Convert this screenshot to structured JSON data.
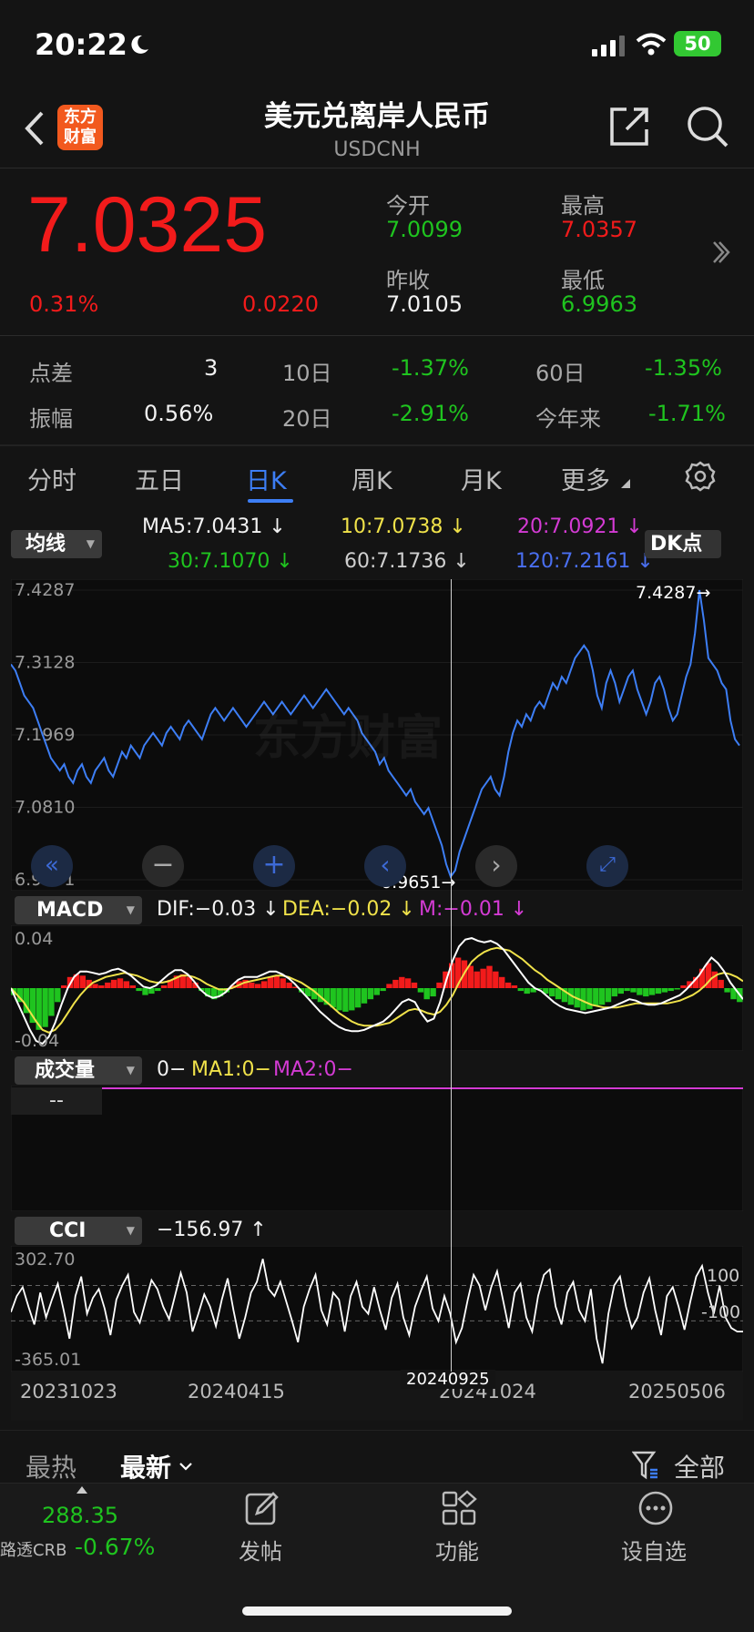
{
  "status": {
    "time": "20:22",
    "battery": "50"
  },
  "header": {
    "title": "美元兑离岸人民币",
    "symbol": "USDCNH",
    "logo_text": "东方财富"
  },
  "quote": {
    "price": "7.0325",
    "change_pct": "0.31%",
    "change": "0.0220",
    "open_label": "今开",
    "open": "7.0099",
    "high_label": "最高",
    "high": "7.0357",
    "prev_label": "昨收",
    "prev": "7.0105",
    "low_label": "最低",
    "low": "6.9963"
  },
  "stats": {
    "spread_label": "点差",
    "spread": "3",
    "d10_label": "10日",
    "d10": "-1.37%",
    "d60_label": "60日",
    "d60": "-1.35%",
    "amp_label": "振幅",
    "amp": "0.56%",
    "d20_label": "20日",
    "d20": "-2.91%",
    "ytd_label": "今年来",
    "ytd": "-1.71%"
  },
  "tabs": [
    {
      "label": "分时"
    },
    {
      "label": "五日"
    },
    {
      "label": "日K"
    },
    {
      "label": "周K"
    },
    {
      "label": "月K"
    },
    {
      "label": "更多"
    }
  ],
  "ma": {
    "pill": "均线",
    "dk": "DK点",
    "ma5": "MA5:7.0431",
    "ma10": "10:7.0738",
    "ma20": "20:7.0921",
    "ma30": "30:7.1070",
    "ma60": "60:7.1736",
    "ma120": "120:7.2161"
  },
  "colors": {
    "accent": "#3d7ef5",
    "up": "#f21b1b",
    "down": "#1fc41f",
    "ma10": "#f0e24a",
    "ma20": "#d43bd4",
    "ma120": "#4a6ff0"
  },
  "chart_data": [
    {
      "type": "line",
      "name": "price",
      "ylim": [
        6.9651,
        7.4287
      ],
      "y_ticks": [
        "7.4287",
        "7.3128",
        "7.1969",
        "7.0810",
        "6.9651"
      ],
      "annotations": {
        "max": "7.4287→",
        "min": "6.9651→"
      },
      "values": [
        7.31,
        7.3,
        7.28,
        7.26,
        7.25,
        7.24,
        7.22,
        7.2,
        7.18,
        7.16,
        7.15,
        7.14,
        7.15,
        7.13,
        7.12,
        7.14,
        7.15,
        7.13,
        7.12,
        7.14,
        7.15,
        7.16,
        7.14,
        7.13,
        7.15,
        7.17,
        7.16,
        7.18,
        7.17,
        7.16,
        7.18,
        7.19,
        7.2,
        7.19,
        7.18,
        7.2,
        7.21,
        7.2,
        7.19,
        7.21,
        7.22,
        7.21,
        7.2,
        7.19,
        7.21,
        7.23,
        7.24,
        7.23,
        7.22,
        7.23,
        7.24,
        7.23,
        7.22,
        7.21,
        7.22,
        7.23,
        7.24,
        7.25,
        7.24,
        7.23,
        7.24,
        7.25,
        7.24,
        7.23,
        7.24,
        7.25,
        7.26,
        7.25,
        7.24,
        7.25,
        7.26,
        7.27,
        7.26,
        7.25,
        7.24,
        7.23,
        7.24,
        7.23,
        7.22,
        7.2,
        7.19,
        7.18,
        7.17,
        7.15,
        7.16,
        7.14,
        7.13,
        7.12,
        7.11,
        7.1,
        7.11,
        7.09,
        7.08,
        7.07,
        7.08,
        7.06,
        7.04,
        7.02,
        6.99,
        6.97,
        6.98,
        7.01,
        7.03,
        7.05,
        7.07,
        7.09,
        7.11,
        7.12,
        7.13,
        7.11,
        7.1,
        7.13,
        7.17,
        7.2,
        7.22,
        7.21,
        7.23,
        7.22,
        7.24,
        7.25,
        7.24,
        7.26,
        7.28,
        7.27,
        7.29,
        7.28,
        7.3,
        7.32,
        7.33,
        7.34,
        7.33,
        7.3,
        7.26,
        7.24,
        7.28,
        7.3,
        7.28,
        7.25,
        7.27,
        7.29,
        7.3,
        7.27,
        7.25,
        7.23,
        7.25,
        7.28,
        7.29,
        7.27,
        7.24,
        7.22,
        7.23,
        7.26,
        7.29,
        7.31,
        7.36,
        7.4287,
        7.38,
        7.32,
        7.31,
        7.3,
        7.28,
        7.27,
        7.22,
        7.19,
        7.18
      ],
      "x_ticks": [
        "20231023",
        "20240415",
        "20241024",
        "20250506"
      ],
      "crosshair_label": "20240925"
    },
    {
      "type": "bar",
      "name": "MACD",
      "legend": {
        "pill": "MACD",
        "dif": "DIF:−0.03",
        "dea": "DEA:−0.02",
        "m": "M:−0.01"
      },
      "ylim": [
        -0.04,
        0.04
      ],
      "y_ticks": [
        "0.04",
        "-0.04"
      ],
      "hist": [
        -0.005,
        -0.01,
        -0.018,
        -0.025,
        -0.03,
        -0.028,
        -0.02,
        -0.01,
        0.002,
        0.008,
        0.01,
        0.009,
        0.006,
        0.003,
        0.002,
        0.004,
        0.006,
        0.007,
        0.005,
        0.002,
        -0.002,
        -0.005,
        -0.004,
        -0.002,
        0.002,
        0.006,
        0.009,
        0.01,
        0.008,
        0.004,
        -0.002,
        -0.006,
        -0.008,
        -0.006,
        -0.003,
        0.002,
        0.005,
        0.006,
        0.004,
        0.003,
        0.005,
        0.008,
        0.009,
        0.007,
        0.004,
        0.001,
        -0.003,
        -0.006,
        -0.008,
        -0.01,
        -0.012,
        -0.014,
        -0.016,
        -0.017,
        -0.016,
        -0.014,
        -0.011,
        -0.008,
        -0.005,
        -0.002,
        0.003,
        0.006,
        0.008,
        0.007,
        0.004,
        -0.003,
        -0.008,
        -0.006,
        0.004,
        0.012,
        0.018,
        0.022,
        0.02,
        0.016,
        0.012,
        0.014,
        0.016,
        0.012,
        0.008,
        0.004,
        0.002,
        -0.002,
        -0.004,
        -0.003,
        -0.001,
        -0.004,
        -0.006,
        -0.008,
        -0.01,
        -0.012,
        -0.014,
        -0.016,
        -0.015,
        -0.013,
        -0.012,
        -0.01,
        -0.006,
        -0.004,
        -0.002,
        -0.003,
        -0.005,
        -0.006,
        -0.005,
        -0.004,
        -0.003,
        -0.002,
        -0.001,
        0.002,
        0.005,
        0.008,
        0.014,
        0.018,
        0.012,
        0.006,
        -0.003,
        -0.008,
        -0.01
      ],
      "dif": [
        0.0,
        -0.01,
        -0.02,
        -0.03,
        -0.038,
        -0.04,
        -0.035,
        -0.025,
        -0.012,
        0.0,
        0.008,
        0.012,
        0.012,
        0.011,
        0.01,
        0.011,
        0.013,
        0.014,
        0.012,
        0.009,
        0.005,
        0.001,
        0.0,
        0.002,
        0.006,
        0.01,
        0.013,
        0.013,
        0.01,
        0.005,
        -0.001,
        -0.005,
        -0.007,
        -0.006,
        -0.003,
        0.002,
        0.006,
        0.008,
        0.008,
        0.008,
        0.01,
        0.012,
        0.012,
        0.01,
        0.007,
        0.003,
        -0.002,
        -0.007,
        -0.012,
        -0.017,
        -0.021,
        -0.025,
        -0.028,
        -0.03,
        -0.031,
        -0.031,
        -0.03,
        -0.028,
        -0.026,
        -0.024,
        -0.02,
        -0.015,
        -0.01,
        -0.008,
        -0.01,
        -0.018,
        -0.024,
        -0.022,
        -0.01,
        0.006,
        0.02,
        0.03,
        0.035,
        0.036,
        0.034,
        0.033,
        0.034,
        0.032,
        0.028,
        0.022,
        0.016,
        0.01,
        0.004,
        0.0,
        -0.002,
        -0.006,
        -0.01,
        -0.013,
        -0.015,
        -0.016,
        -0.017,
        -0.018,
        -0.017,
        -0.016,
        -0.015,
        -0.014,
        -0.012,
        -0.01,
        -0.008,
        -0.009,
        -0.011,
        -0.012,
        -0.012,
        -0.011,
        -0.009,
        -0.007,
        -0.005,
        -0.001,
        0.004,
        0.009,
        0.016,
        0.022,
        0.018,
        0.012,
        0.004,
        -0.002,
        -0.008
      ],
      "dea": [
        0.0,
        -0.005,
        -0.01,
        -0.017,
        -0.024,
        -0.03,
        -0.032,
        -0.03,
        -0.025,
        -0.018,
        -0.011,
        -0.005,
        0.0,
        0.004,
        0.006,
        0.008,
        0.009,
        0.01,
        0.011,
        0.01,
        0.009,
        0.007,
        0.005,
        0.004,
        0.004,
        0.005,
        0.007,
        0.009,
        0.009,
        0.008,
        0.006,
        0.003,
        0.001,
        -0.001,
        -0.001,
        0.0,
        0.002,
        0.004,
        0.005,
        0.006,
        0.007,
        0.008,
        0.009,
        0.009,
        0.008,
        0.006,
        0.004,
        0.001,
        -0.002,
        -0.006,
        -0.01,
        -0.014,
        -0.018,
        -0.021,
        -0.024,
        -0.026,
        -0.027,
        -0.027,
        -0.027,
        -0.026,
        -0.025,
        -0.022,
        -0.019,
        -0.016,
        -0.015,
        -0.016,
        -0.018,
        -0.019,
        -0.017,
        -0.012,
        -0.005,
        0.004,
        0.012,
        0.019,
        0.023,
        0.026,
        0.028,
        0.029,
        0.028,
        0.027,
        0.024,
        0.021,
        0.017,
        0.013,
        0.01,
        0.006,
        0.003,
        0.0,
        -0.003,
        -0.006,
        -0.008,
        -0.01,
        -0.012,
        -0.013,
        -0.014,
        -0.014,
        -0.014,
        -0.013,
        -0.012,
        -0.011,
        -0.011,
        -0.011,
        -0.011,
        -0.011,
        -0.011,
        -0.01,
        -0.009,
        -0.007,
        -0.005,
        -0.002,
        0.002,
        0.007,
        0.01,
        0.011,
        0.01,
        0.008,
        0.005
      ]
    },
    {
      "type": "bar",
      "name": "volume",
      "legend": {
        "pill": "成交量",
        "v": "0−",
        "ma1": "MA1:0−",
        "ma2": "MA2:0−"
      },
      "y_ticks": [
        "--"
      ]
    },
    {
      "type": "line",
      "name": "CCI",
      "legend": {
        "pill": "CCI",
        "value": "−156.97"
      },
      "ylim": [
        -365.01,
        302.7
      ],
      "y_ticks": [
        "302.70",
        "-365.01"
      ],
      "ref_lines": [
        "100",
        "-100"
      ],
      "values": [
        -50,
        40,
        90,
        -20,
        -120,
        60,
        -80,
        20,
        110,
        -40,
        -200,
        40,
        150,
        -60,
        30,
        80,
        -30,
        -180,
        20,
        100,
        160,
        -50,
        -110,
        10,
        130,
        80,
        -20,
        -90,
        40,
        170,
        60,
        -160,
        -60,
        50,
        -20,
        -130,
        20,
        140,
        -40,
        -200,
        -80,
        60,
        120,
        250,
        80,
        40,
        120,
        10,
        -100,
        -220,
        -20,
        80,
        160,
        -40,
        -120,
        60,
        20,
        -160,
        40,
        120,
        -20,
        -60,
        90,
        -40,
        -150,
        30,
        110,
        -80,
        -180,
        -20,
        70,
        150,
        -30,
        -100,
        40,
        -60,
        -220,
        -140,
        20,
        160,
        100,
        -40,
        90,
        180,
        20,
        -140,
        60,
        110,
        -80,
        -160,
        40,
        160,
        190,
        -20,
        -120,
        60,
        120,
        -40,
        -100,
        80,
        -200,
        -340,
        -60,
        100,
        150,
        -20,
        -140,
        -80,
        60,
        140,
        -40,
        -180,
        40,
        90,
        -20,
        -150,
        10,
        150,
        210,
        60,
        -60,
        100,
        -80,
        -140,
        -160,
        -160
      ]
    }
  ],
  "news": {
    "tab_hot": "最热",
    "tab_new": "最新",
    "filter": "全部"
  },
  "ticker": {
    "name": "路透CRB",
    "value": "288.35",
    "change": "-0.67%"
  },
  "nav": [
    {
      "label": "发帖"
    },
    {
      "label": "功能"
    },
    {
      "label": "设自选"
    }
  ]
}
